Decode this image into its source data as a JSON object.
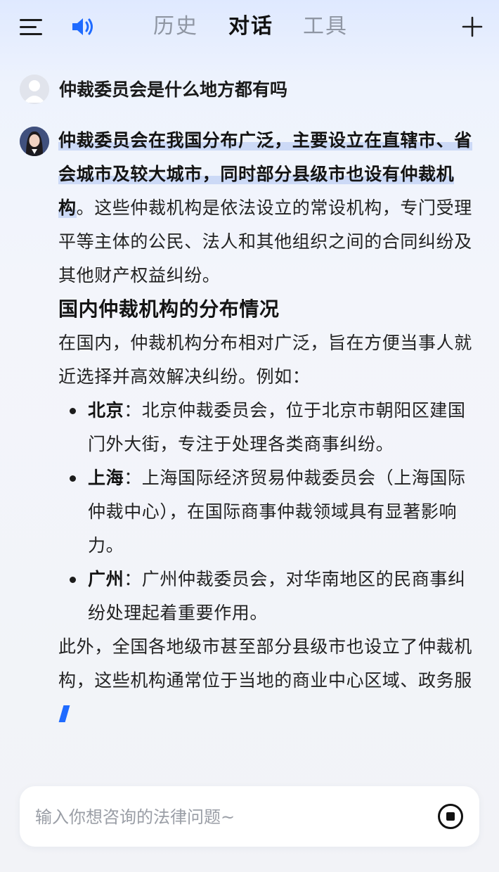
{
  "header": {
    "tabs": [
      {
        "label": "历史",
        "active": false
      },
      {
        "label": "对话",
        "active": true
      },
      {
        "label": "工具",
        "active": false
      }
    ],
    "icons": [
      "menu-icon",
      "speaker-icon",
      "plus-icon"
    ],
    "accent_color": "#1f6bff"
  },
  "conversation": {
    "user_question": "仲裁委员会是什么地方都有吗",
    "answer": {
      "intro_highlight": "仲裁委员会在我国分布广泛，主要设立在直辖市、省会城市及较大城市，同时部分县级市也设有仲裁机构",
      "intro_rest": "。这些仲裁机构是依法设立的常设机构，专门受理平等主体的公民、法人和其他组织之间的合同纠纷及其他财产权益纠纷。",
      "heading": "国内仲裁机构的分布情况",
      "lead": "在国内，仲裁机构分布相对广泛，旨在方便当事人就近选择并高效解决纠纷。例如：",
      "items": [
        {
          "city": "北京",
          "text": "：北京仲裁委员会，位于北京市朝阳区建国门外大街，专注于处理各类商事纠纷。"
        },
        {
          "city": "上海",
          "text": "：上海国际经济贸易仲裁委员会（上海国际仲裁中心），在国际商事仲裁领域具有显著影响力。"
        },
        {
          "city": "广州",
          "text": "：广州仲裁委员会，对华南地区的民商事纠纷处理起着重要作用。"
        }
      ],
      "tail": "此外，全国各地级市甚至部分县级市也设立了仲裁机构，这些机构通常位于当地的商业中心区域、政务服"
    }
  },
  "input": {
    "placeholder": "输入你想咨询的法律问题~",
    "value": ""
  }
}
